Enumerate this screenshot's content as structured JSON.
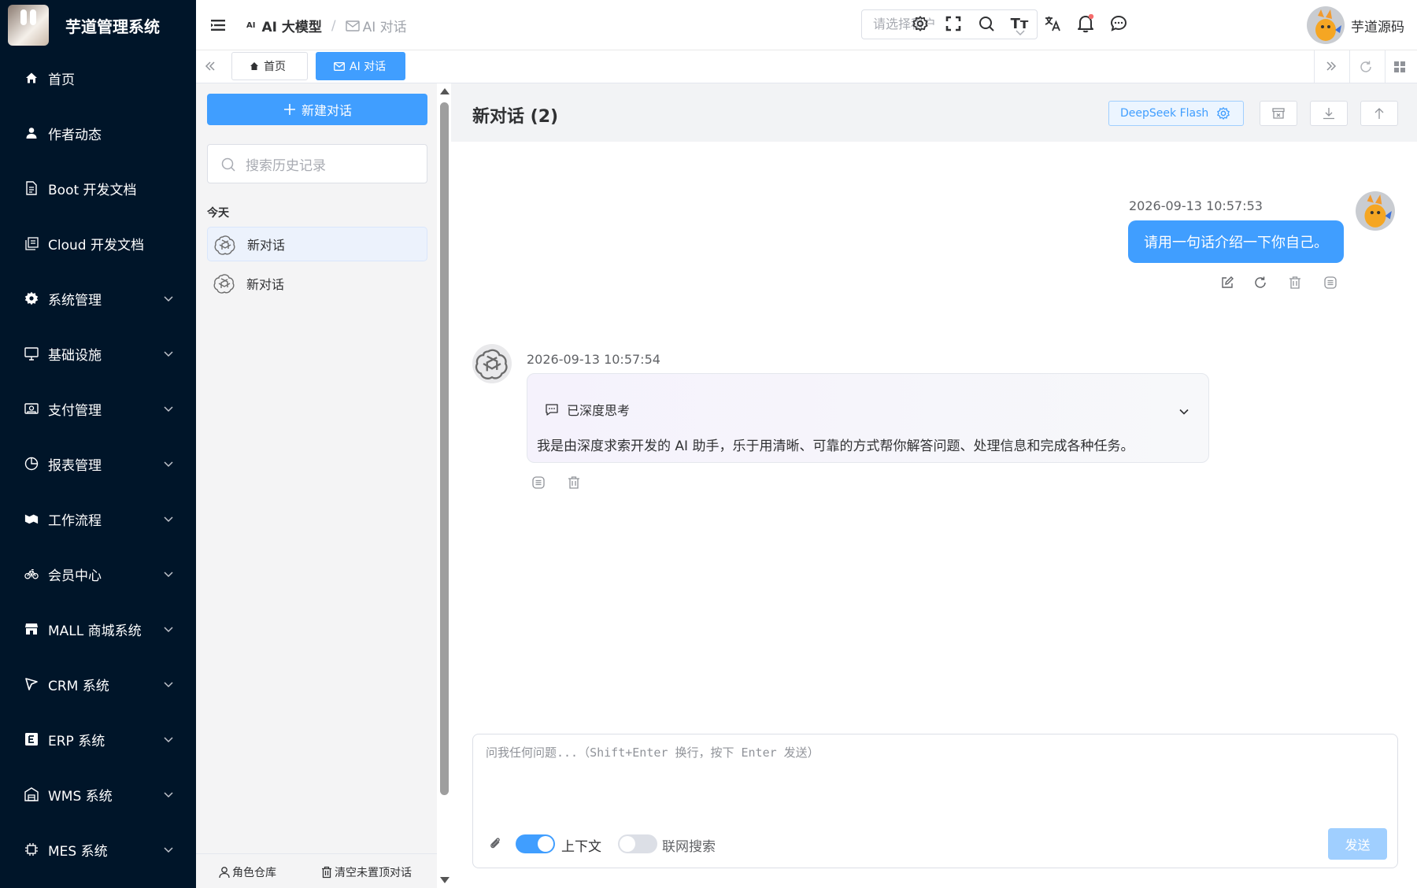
{
  "app": {
    "title": "芋道管理系统"
  },
  "sidebar": {
    "items": [
      {
        "label": "首页",
        "icon": "home-icon",
        "expandable": false
      },
      {
        "label": "作者动态",
        "icon": "user-icon",
        "expandable": false
      },
      {
        "label": "Boot 开发文档",
        "icon": "document-icon",
        "expandable": false
      },
      {
        "label": "Cloud 开发文档",
        "icon": "documents-icon",
        "expandable": false
      },
      {
        "label": "系统管理",
        "icon": "gear-icon",
        "expandable": true
      },
      {
        "label": "基础设施",
        "icon": "monitor-icon",
        "expandable": true
      },
      {
        "label": "支付管理",
        "icon": "payment-icon",
        "expandable": true
      },
      {
        "label": "报表管理",
        "icon": "pie-chart-icon",
        "expandable": true
      },
      {
        "label": "工作流程",
        "icon": "workflow-icon",
        "expandable": true
      },
      {
        "label": "会员中心",
        "icon": "bike-icon",
        "expandable": true
      },
      {
        "label": "MALL 商城系统",
        "icon": "shop-icon",
        "expandable": true
      },
      {
        "label": "CRM 系统",
        "icon": "crm-icon",
        "expandable": true
      },
      {
        "label": "ERP 系统",
        "icon": "erp-icon",
        "expandable": true
      },
      {
        "label": "WMS 系统",
        "icon": "warehouse-icon",
        "expandable": true
      },
      {
        "label": "MES 系统",
        "icon": "chip-icon",
        "expandable": true
      }
    ]
  },
  "header": {
    "breadcrumb": {
      "root": "AI 大模型",
      "root_badge": "AI",
      "current": "AI 对话",
      "separator": "/"
    },
    "tenant_placeholder": "请选择租户",
    "username": "芋道源码"
  },
  "tabs": [
    {
      "label": "首页",
      "icon": "home-icon",
      "active": false
    },
    {
      "label": "AI 对话",
      "icon": "mail-icon",
      "active": true
    }
  ],
  "conversations": {
    "new_button": "新建对话",
    "search_placeholder": "搜索历史记录",
    "group_label": "今天",
    "items": [
      {
        "title": "新对话",
        "active": true
      },
      {
        "title": "新对话",
        "active": false
      }
    ],
    "footer": {
      "role_library": "角色仓库",
      "clear_unpinned": "清空未置顶对话"
    }
  },
  "chat": {
    "title": "新对话 (2)",
    "model": "DeepSeek Flash",
    "messages": [
      {
        "role": "user",
        "time": "2026-09-13 10:57:53",
        "content": "请用一句话介绍一下你自己。"
      },
      {
        "role": "assistant",
        "time": "2026-09-13 10:57:54",
        "thinking_label": "已深度思考",
        "content": "我是由深度求索开发的 AI 助手，乐于用清晰、可靠的方式帮你解答问题、处理信息和完成各种任务。"
      }
    ]
  },
  "input": {
    "placeholder": "问我任何问题...（Shift+Enter 换行，按下 Enter 发送）",
    "context_label": "上下文",
    "context_enabled": true,
    "web_search_label": "联网搜索",
    "web_search_enabled": false,
    "send_label": "发送"
  },
  "colors": {
    "sidebar_bg": "#001529",
    "primary": "#409eff",
    "send_disabled": "#a0cfff",
    "notification_dot": "#f56c6c"
  }
}
